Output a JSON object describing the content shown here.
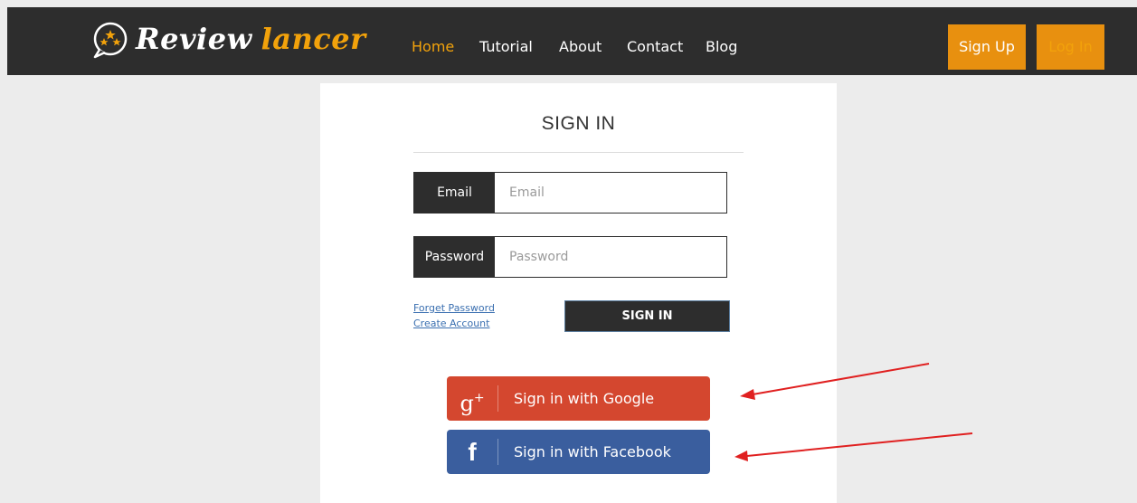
{
  "brand": {
    "word1": "Review",
    "word2": "lancer",
    "logo_icon": "chat-bubble-stars-icon"
  },
  "nav": {
    "links": [
      "Home",
      "Tutorial",
      "About",
      "Contact",
      "Blog"
    ],
    "active": "Home",
    "signup_label": "Sign Up",
    "login_label": "Log In"
  },
  "signin": {
    "title": "SIGN IN",
    "email": {
      "label": "Email",
      "placeholder": "Email",
      "value": ""
    },
    "password": {
      "label": "Password",
      "placeholder": "Password",
      "value": ""
    },
    "forget_password": "Forget Password",
    "create_account": "Create Account",
    "submit_label": "SIGN IN"
  },
  "social": {
    "google": {
      "icon_text": "g",
      "icon_sup": "+",
      "label": "Sign in with Google"
    },
    "facebook": {
      "icon_text": "f",
      "label": "Sign in with Facebook"
    }
  },
  "colors": {
    "navbar": "#2d2d2d",
    "accent": "#f2a20b",
    "button_orange": "#e8900f",
    "google": "#d4472f",
    "facebook": "#3a5e9e",
    "annotation_arrow": "#e02020"
  }
}
